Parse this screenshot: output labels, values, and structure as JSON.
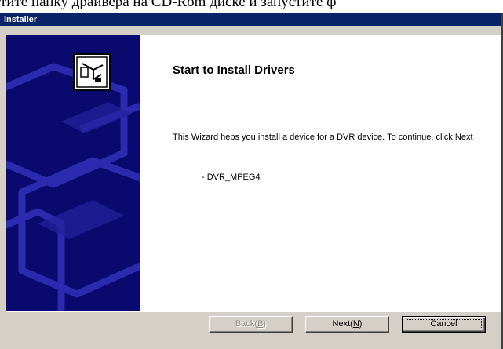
{
  "document": {
    "caption_line": "тите папку драйвера на CD-Rom диске и запустите ф"
  },
  "window": {
    "title": "Installer"
  },
  "wizard": {
    "heading": "Start to Install Drivers",
    "description": "This Wizard heps you install a device for a DVR device. To continue, click Next",
    "device_item": "- DVR_MPEG4"
  },
  "buttons": {
    "back": {
      "text": "Back",
      "hotkey": "B",
      "enabled": false
    },
    "next": {
      "text": "Next",
      "hotkey": "N",
      "enabled": true
    },
    "cancel": {
      "text": "Cancel",
      "enabled": true,
      "default": true
    }
  },
  "colors": {
    "titlebar": "#0a246a",
    "sidepanel": "#0a0a6e",
    "dialog_face": "#d4d0c8"
  },
  "icons": {
    "side_panel_icon": "hardware-install-icon"
  }
}
